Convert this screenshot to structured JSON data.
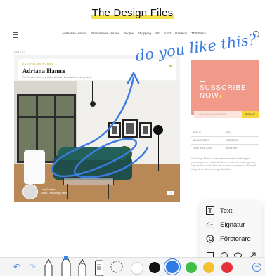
{
  "site": {
    "title": "The Design Files",
    "nav": [
      "Australian Homes",
      "International Homes",
      "People",
      "Shopping",
      "Art",
      "Food",
      "Gardens",
      "TDF Films"
    ],
    "section_label": "LATEST",
    "card": {
      "tag": "AUSTRALIAN HOMES",
      "title": "Adriana Hanna",
      "subtitle": "The Preston home of architect Adriana Hanna and her young family."
    },
    "photo_byline": "Lucy Feagins\nEditor, The Design Files",
    "subscribe": {
      "title_line1": "SUBSCRIBE",
      "title_line2": "NOW",
      "email_placeholder": "YOUR EMAIL ADDRESS",
      "button": "SIGN UP"
    },
    "links": [
      [
        "ABOUT",
        "FAQ"
      ],
      [
        "ADVERTISING",
        "CONTACT"
      ],
      [
        "CONTRIBUTORS",
        "ARCHIVE"
      ]
    ],
    "footer_text": "The Design Files is a registered trademark and all original photographs are protected. Please send us an email regarding any use of our work. Feel free to share our images on Pinterest using the credit via sharing official links."
  },
  "annotation": {
    "text": "do you like this?",
    "color": "#3c7be0"
  },
  "markup_menu": {
    "items": [
      {
        "label": "Text",
        "icon": "text-box-icon"
      },
      {
        "label": "Signatur",
        "icon": "signature-icon"
      },
      {
        "label": "Förstorare",
        "icon": "magnifier-icon"
      }
    ],
    "shapes": [
      "square-shape-icon",
      "circle-shape-icon",
      "speech-bubble-icon",
      "arrow-shape-icon"
    ]
  },
  "toolbar": {
    "tools": [
      "pen-tool",
      "marker-tool",
      "pencil-tool",
      "eraser-tool",
      "lasso-tool"
    ],
    "colors": [
      "#ffffff",
      "#111111",
      "#2f7be6",
      "#3fbf4a",
      "#f2c12e",
      "#e5303a"
    ],
    "selected_color": "#2f7be6"
  }
}
